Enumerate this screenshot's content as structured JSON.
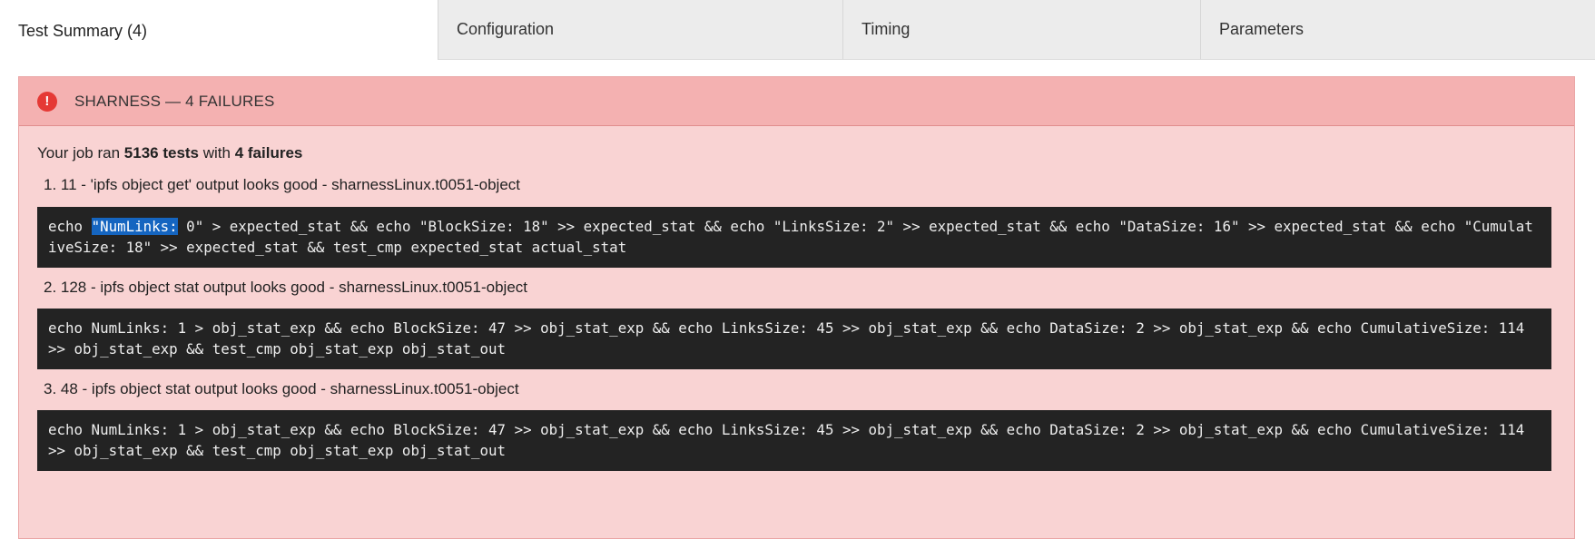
{
  "tabs": [
    {
      "label": "Test Summary (4)",
      "active": true
    },
    {
      "label": "Configuration",
      "active": false
    },
    {
      "label": "Timing",
      "active": false
    },
    {
      "label": "Parameters",
      "active": false
    }
  ],
  "panel": {
    "header_title": "SHARNESS — 4 FAILURES",
    "icon": "alert-circle-icon",
    "header_color": "#f4b1b1",
    "body_color": "#f9d3d3",
    "summary": {
      "prefix": "Your job ran ",
      "tests": "5136 tests",
      "middle": " with ",
      "failures": "4 failures"
    },
    "failures": [
      {
        "title": "1. 11 - 'ipfs object get' output looks good - sharnessLinux.t0051-object",
        "code_before": "echo ",
        "code_highlight": "\"NumLinks:",
        "code_after": " 0\" > expected_stat && echo \"BlockSize: 18\" >> expected_stat && echo \"LinksSize: 2\" >> expected_stat && echo \"DataSize: 16\" >> expected_stat && echo \"CumulativeSize: 18\" >> expected_stat && test_cmp expected_stat actual_stat"
      },
      {
        "title": "2. 128 - ipfs object stat output looks good - sharnessLinux.t0051-object",
        "code": "echo NumLinks: 1 > obj_stat_exp && echo BlockSize: 47 >> obj_stat_exp && echo LinksSize: 45 >> obj_stat_exp && echo DataSize: 2 >> obj_stat_exp && echo CumulativeSize: 114 >> obj_stat_exp && test_cmp obj_stat_exp obj_stat_out"
      },
      {
        "title": "3. 48 - ipfs object stat output looks good - sharnessLinux.t0051-object",
        "code": "echo NumLinks: 1 > obj_stat_exp && echo BlockSize: 47 >> obj_stat_exp && echo LinksSize: 45 >> obj_stat_exp && echo DataSize: 2 >> obj_stat_exp && echo CumulativeSize: 114 >> obj_stat_exp && test_cmp obj_stat_exp obj_stat_out"
      }
    ]
  }
}
